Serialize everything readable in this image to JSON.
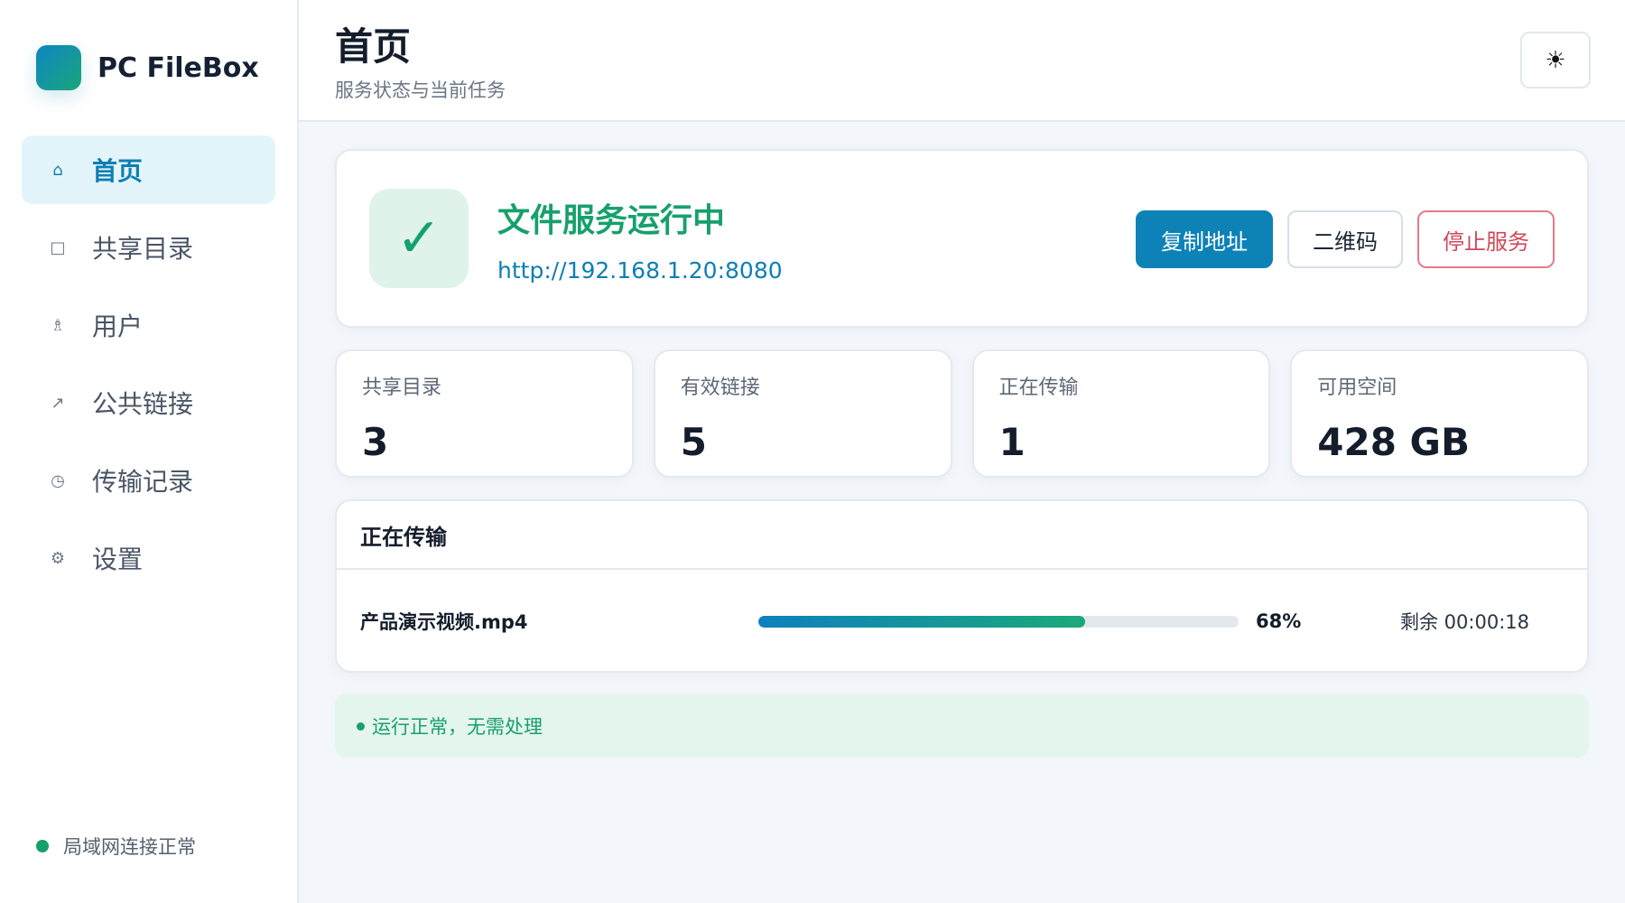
{
  "app": {
    "name": "PC FileBox"
  },
  "sidebar": {
    "items": [
      {
        "label": "首页",
        "icon": "home-icon",
        "active": true
      },
      {
        "label": "共享目录",
        "icon": "folder-icon",
        "active": false
      },
      {
        "label": "用户",
        "icon": "user-icon",
        "active": false
      },
      {
        "label": "公共链接",
        "icon": "link-icon",
        "active": false
      },
      {
        "label": "传输记录",
        "icon": "clock-icon",
        "active": false
      },
      {
        "label": "设置",
        "icon": "gear-icon",
        "active": false
      }
    ],
    "status": "局域网连接正常"
  },
  "header": {
    "title": "首页",
    "subtitle": "服务状态与当前任务",
    "theme_icon": "sun-icon"
  },
  "service": {
    "status": "文件服务运行中",
    "url": "http://192.168.1.20:8080",
    "copy_label": "复制地址",
    "qr_label": "二维码",
    "stop_label": "停止服务"
  },
  "stats": [
    {
      "label": "共享目录",
      "value": "3"
    },
    {
      "label": "有效链接",
      "value": "5"
    },
    {
      "label": "正在传输",
      "value": "1"
    },
    {
      "label": "可用空间",
      "value": "428 GB"
    }
  ],
  "transfers": {
    "title": "正在传输",
    "items": [
      {
        "file": "产品演示视频.mp4",
        "progress": 68,
        "percent": "68%",
        "remaining": "剩余 00:00:18"
      }
    ]
  },
  "notice": "运行正常，无需处理",
  "colors": {
    "accent": "#0d82b7",
    "success": "#17a06c",
    "danger": "#d0475a"
  }
}
